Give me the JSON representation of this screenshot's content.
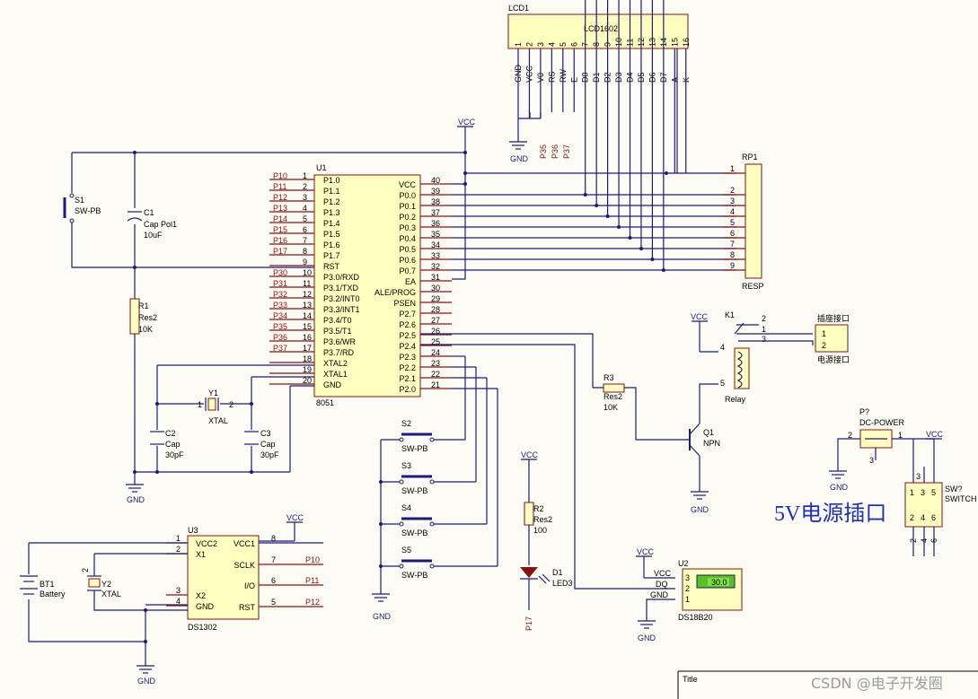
{
  "lcd": {
    "designator": "LCD1",
    "name": "LCD1602",
    "pin_numbers": [
      "1",
      "2",
      "3",
      "4",
      "5",
      "6",
      "7",
      "8",
      "9",
      "10",
      "11",
      "12",
      "13",
      "14",
      "15",
      "16"
    ],
    "pin_names": [
      "GND",
      "VCC",
      "V0",
      "RS",
      "RW",
      "E",
      "D0",
      "D1",
      "D2",
      "D3",
      "D4",
      "D5",
      "D6",
      "D7",
      "A",
      "K"
    ]
  },
  "lcd_ctrl_nets": [
    "P35",
    "P36",
    "P37"
  ],
  "mcu": {
    "designator": "U1",
    "name": "8051",
    "left_pins": [
      {
        "num": "1",
        "name": "P1.0",
        "net": "P10"
      },
      {
        "num": "2",
        "name": "P1.1",
        "net": "P11"
      },
      {
        "num": "3",
        "name": "P1.2",
        "net": "P12"
      },
      {
        "num": "4",
        "name": "P1.3",
        "net": "P13"
      },
      {
        "num": "5",
        "name": "P1.4",
        "net": "P14"
      },
      {
        "num": "6",
        "name": "P1.5",
        "net": "P15"
      },
      {
        "num": "7",
        "name": "P1.6",
        "net": "P16"
      },
      {
        "num": "8",
        "name": "P1.7",
        "net": "P17"
      },
      {
        "num": "9",
        "name": "RST",
        "net": ""
      },
      {
        "num": "10",
        "name": "P3.0/RXD",
        "net": "P30"
      },
      {
        "num": "11",
        "name": "P3.1/TXD",
        "net": "P31"
      },
      {
        "num": "12",
        "name": "P3.2/INT0",
        "net": "P32"
      },
      {
        "num": "13",
        "name": "P3.3/INT1",
        "net": "P33"
      },
      {
        "num": "14",
        "name": "P3.4/T0",
        "net": "P34"
      },
      {
        "num": "15",
        "name": "P3.5/T1",
        "net": "P35"
      },
      {
        "num": "16",
        "name": "P3.6/WR",
        "net": "P36"
      },
      {
        "num": "17",
        "name": "P3.7/RD",
        "net": "P37"
      },
      {
        "num": "18",
        "name": "XTAL2",
        "net": ""
      },
      {
        "num": "19",
        "name": "XTAL1",
        "net": ""
      },
      {
        "num": "20",
        "name": "GND",
        "net": ""
      }
    ],
    "right_pins": [
      {
        "num": "40",
        "name": "VCC"
      },
      {
        "num": "39",
        "name": "P0.0"
      },
      {
        "num": "38",
        "name": "P0.1"
      },
      {
        "num": "37",
        "name": "P0.2"
      },
      {
        "num": "36",
        "name": "P0.3"
      },
      {
        "num": "35",
        "name": "P0.4"
      },
      {
        "num": "34",
        "name": "P0.5"
      },
      {
        "num": "33",
        "name": "P0.6"
      },
      {
        "num": "32",
        "name": "P0.7"
      },
      {
        "num": "31",
        "name": "EA"
      },
      {
        "num": "30",
        "name": "ALE/PROG"
      },
      {
        "num": "29",
        "name": "PSEN"
      },
      {
        "num": "28",
        "name": "P2.7"
      },
      {
        "num": "27",
        "name": "P2.6"
      },
      {
        "num": "26",
        "name": "P2.5"
      },
      {
        "num": "25",
        "name": "P2.4"
      },
      {
        "num": "24",
        "name": "P2.3"
      },
      {
        "num": "23",
        "name": "P2.2"
      },
      {
        "num": "22",
        "name": "P2.1"
      },
      {
        "num": "21",
        "name": "P2.0"
      }
    ]
  },
  "rp1": {
    "designator": "RP1",
    "name": "RESP",
    "pins": [
      "1",
      "2",
      "3",
      "4",
      "5",
      "6",
      "7",
      "8",
      "9"
    ]
  },
  "s1": {
    "designator": "S1",
    "name": "SW-PB"
  },
  "c1": {
    "designator": "C1",
    "name": "Cap Pol1",
    "value": "10uF"
  },
  "r1": {
    "designator": "R1",
    "name": "Res2",
    "value": "10K"
  },
  "y1": {
    "designator": "Y1",
    "name": "XTAL",
    "p1": "1",
    "p2": "2"
  },
  "c2": {
    "designator": "C2",
    "name": "Cap",
    "value": "30pF"
  },
  "c3": {
    "designator": "C3",
    "name": "Cap",
    "value": "30pF"
  },
  "switches": [
    {
      "designator": "S2",
      "name": "SW-PB"
    },
    {
      "designator": "S3",
      "name": "SW-PB"
    },
    {
      "designator": "S4",
      "name": "SW-PB"
    },
    {
      "designator": "S5",
      "name": "SW-PB"
    }
  ],
  "k1": {
    "designator": "K1",
    "name": "Relay",
    "pins": [
      "2",
      "1",
      "3",
      "4",
      "5"
    ]
  },
  "out_conn": {
    "label_top": "插座接口",
    "label_bottom": "电源接口",
    "pins": [
      "1",
      "2"
    ]
  },
  "r3": {
    "designator": "R3",
    "name": "Res2",
    "value": "10K"
  },
  "q1": {
    "designator": "Q1",
    "name": "NPN"
  },
  "p7": {
    "designator": "P?",
    "name": "DC-POWER",
    "pins": [
      "2",
      "1",
      "3"
    ]
  },
  "sw": {
    "designator": "SW?",
    "name": "SWITCH",
    "top_pins": [
      "1",
      "3",
      "5"
    ],
    "bottom_pins": [
      "2",
      "4",
      "6"
    ]
  },
  "big_label": "5V电源插口",
  "r2": {
    "designator": "R2",
    "name": "Res2",
    "value": "100"
  },
  "d1": {
    "designator": "D1",
    "name": "LED3",
    "net": "P17"
  },
  "u2": {
    "designator": "U2",
    "name": "DS18B20",
    "pins": [
      {
        "num": "3",
        "name": "VCC"
      },
      {
        "num": "2",
        "name": "DQ"
      },
      {
        "num": "1",
        "name": "GND"
      }
    ],
    "display": "30.0"
  },
  "u3": {
    "designator": "U3",
    "name": "DS1302",
    "left_pins": [
      {
        "num": "1",
        "name": "VCC2"
      },
      {
        "num": "2",
        "name": "X1"
      },
      {
        "num": "3",
        "name": "X2"
      },
      {
        "num": "4",
        "name": "GND"
      }
    ],
    "right_pins": [
      {
        "num": "8",
        "name": "VCC1"
      },
      {
        "num": "7",
        "name": "SCLK"
      },
      {
        "num": "6",
        "name": "I/O"
      },
      {
        "num": "5",
        "name": "RST"
      }
    ],
    "nets": [
      "P10",
      "P11",
      "P12"
    ]
  },
  "bt1": {
    "designator": "BT1",
    "name": "Battery"
  },
  "y2": {
    "designator": "Y2",
    "name": "XTAL",
    "pin": "2"
  },
  "power": {
    "vcc": "VCC",
    "gnd": "GND"
  },
  "title_block": {
    "label": "Title"
  },
  "watermark": "CSDN @电子开发圈"
}
